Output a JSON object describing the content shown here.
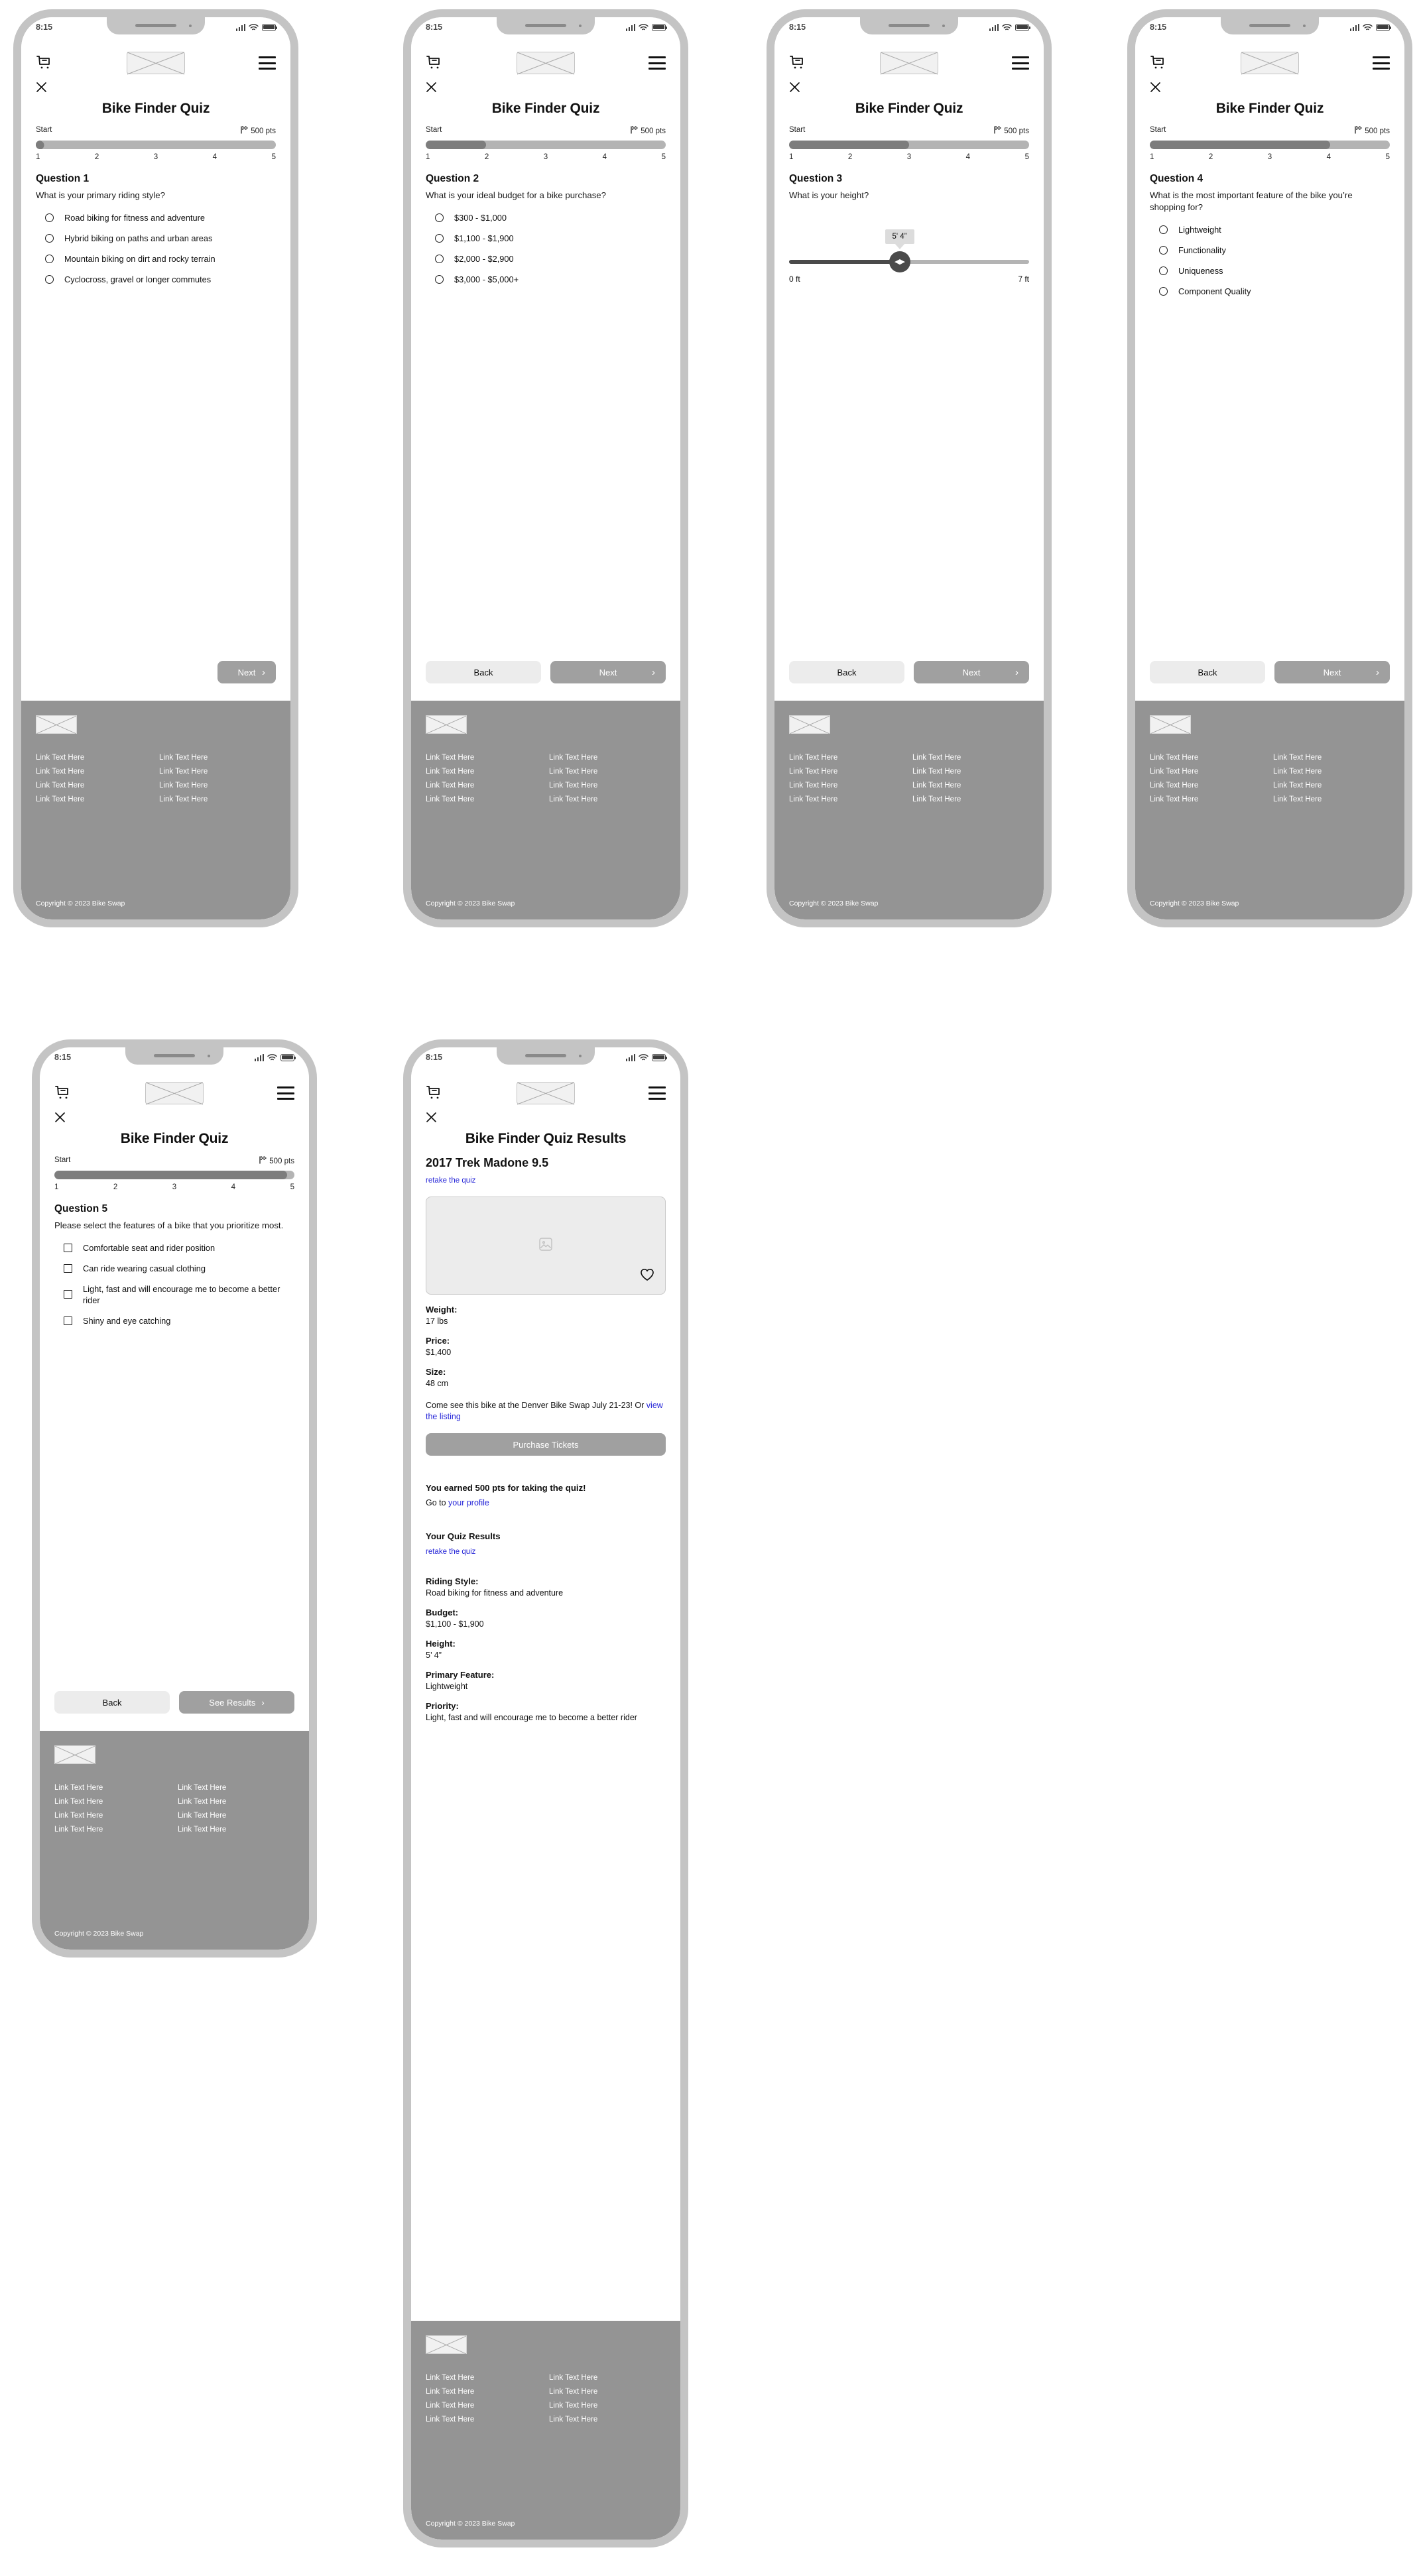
{
  "status_bar": {
    "time": "8:15"
  },
  "header": {
    "cart_icon": "shopping-cart-icon",
    "logo_placeholder": "logo-placeholder-image",
    "menu_icon": "hamburger-menu-icon",
    "close_icon": "close-x-icon"
  },
  "quiz_title": "Bike Finder Quiz",
  "results_title": "Bike Finder Quiz Results",
  "progress": {
    "start_label": "Start",
    "goal_label": "500 pts",
    "flag_icon": "checkered-flag-icon",
    "steps": [
      "1",
      "2",
      "3",
      "4",
      "5"
    ]
  },
  "buttons": {
    "back": "Back",
    "next": "Next",
    "see_results": "See Results",
    "purchase_tickets": "Purchase Tickets",
    "chevron": "›"
  },
  "screens": [
    {
      "id": "question-1",
      "progress_percent": 3,
      "q_head": "Question 1",
      "q_text": "What is your primary riding style?",
      "input_type": "radio",
      "options": [
        "Road biking for fitness and adventure",
        "Hybrid biking on paths and urban areas",
        "Mountain biking on dirt and rocky terrain",
        "Cyclocross, gravel or longer commutes"
      ]
    },
    {
      "id": "question-2",
      "progress_percent": 25,
      "q_head": "Question 2",
      "q_text": "What is your ideal budget for a bike purchase?",
      "input_type": "radio",
      "options": [
        "$300 - $1,000",
        "$1,100 - $1,900",
        "$2,000 - $2,900",
        "$3,000 - $5,000+"
      ]
    },
    {
      "id": "question-3",
      "progress_percent": 50,
      "q_head": "Question 3",
      "q_text": "What is your height?",
      "input_type": "slider",
      "slider": {
        "value_label": "5' 4”",
        "min_label": "0 ft",
        "max_label": "7 ft",
        "thumb_percent": 46
      }
    },
    {
      "id": "question-4",
      "progress_percent": 75,
      "q_head": "Question 4",
      "q_text": "What is the most important feature of the bike you’re shopping for?",
      "input_type": "radio",
      "options": [
        "Lightweight",
        "Functionality",
        "Uniqueness",
        "Component Quality"
      ]
    },
    {
      "id": "question-5",
      "progress_percent": 97,
      "q_head": "Question 5",
      "q_text": "Please select the features of a bike that you prioritize most.",
      "input_type": "checkbox",
      "options": [
        "Comfortable seat and rider position",
        "Can ride wearing casual clothing",
        "Light, fast and will encourage me to become a better rider",
        "Shiny and eye catching"
      ]
    }
  ],
  "results": {
    "bike_name": "2017 Trek Madone 9.5",
    "retake_link": "retake the quiz",
    "image_placeholder_icon": "image-placeholder-icon",
    "favorite_icon": "heart-icon",
    "specs": [
      {
        "label": "Weight:",
        "value": "17 lbs"
      },
      {
        "label": "Price:",
        "value": "$1,400"
      },
      {
        "label": "Size:",
        "value": "48 cm"
      }
    ],
    "note_before": "Come see this bike at the Denver Bike Swap July 21-23! Or ",
    "note_link": "view the listing",
    "points_message": "You earned 500 pts for taking the quiz!",
    "goto_prefix": "Go to ",
    "goto_link": "your profile",
    "your_results_heading": "Your Quiz Results",
    "your_results_retake": "retake the quiz",
    "summary": [
      {
        "label": "Riding Style:",
        "value": "Road biking for fitness and adventure"
      },
      {
        "label": "Budget:",
        "value": "$1,100 - $1,900"
      },
      {
        "label": "Height:",
        "value": "5’ 4”"
      },
      {
        "label": "Primary Feature:",
        "value": "Lightweight"
      },
      {
        "label": "Priority:",
        "value": "Light, fast and will encourage me to become a better rider"
      }
    ]
  },
  "footer": {
    "logo_placeholder": "footer-logo-placeholder",
    "links": [
      "Link Text Here",
      "Link Text Here",
      "Link Text Here",
      "Link Text Here",
      "Link Text Here",
      "Link Text Here",
      "Link Text Here",
      "Link Text Here"
    ],
    "copyright": "Copyright © 2023 Bike Swap"
  },
  "colors": {
    "frame": "#c4c4c4",
    "progress_fill": "#7d7d7d",
    "progress_track": "#b4b4b4",
    "primary_button": "#a0a0a0",
    "secondary_button": "#ececec",
    "footer_bg": "#949494",
    "link": "#2727d8"
  }
}
